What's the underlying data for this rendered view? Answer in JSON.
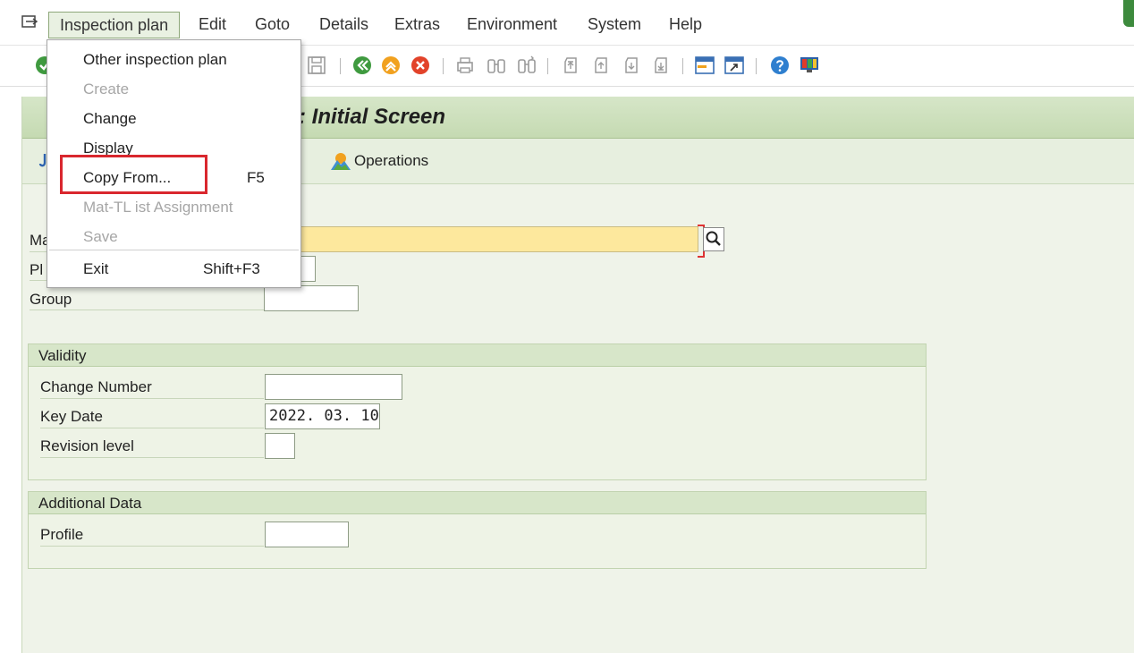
{
  "menubar": {
    "items": [
      "Inspection plan",
      "Edit",
      "Goto",
      "Details",
      "Extras",
      "Environment",
      "System",
      "Help"
    ]
  },
  "toolbar": {
    "icons": [
      "check-icon",
      "save-icon",
      "back-icon",
      "exit-icon",
      "cancel-icon",
      "print-icon",
      "find-icon",
      "find-next-icon",
      "first-page-icon",
      "previous-page-icon",
      "next-page-icon",
      "last-page-icon",
      "create-session-icon",
      "shortcut-icon",
      "help-icon",
      "customize-layout-icon"
    ]
  },
  "screen": {
    "title": ": Initial Screen",
    "operations_label": "Operations"
  },
  "form": {
    "material_label": "Ma",
    "plant_label": "Pl",
    "group_label": "Group",
    "validity": {
      "title": "Validity",
      "change_number_label": "Change Number",
      "key_date_label": "Key Date",
      "key_date_value": "2022. 03. 10",
      "revision_level_label": "Revision level"
    },
    "additional": {
      "title": "Additional Data",
      "profile_label": "Profile"
    }
  },
  "dropdown": {
    "items": [
      {
        "label": "Other inspection plan",
        "shortcut": "",
        "enabled": true
      },
      {
        "label": "Create",
        "shortcut": "",
        "enabled": false
      },
      {
        "label": "Change",
        "shortcut": "",
        "enabled": true
      },
      {
        "label": "Display",
        "shortcut": "",
        "enabled": true
      },
      {
        "label": "Copy From...",
        "shortcut": "F5",
        "enabled": true
      },
      {
        "label": "Mat-TL ist Assignment",
        "shortcut": "",
        "enabled": false
      },
      {
        "label": "Save",
        "shortcut": "",
        "enabled": false
      },
      {
        "label": "Exit",
        "shortcut": "Shift+F3",
        "enabled": true
      }
    ]
  },
  "colors": {
    "required_field": "#fde89d",
    "title_bar": "#d6e6c8",
    "highlight": "#d9272e",
    "background": "#eff3e9"
  }
}
